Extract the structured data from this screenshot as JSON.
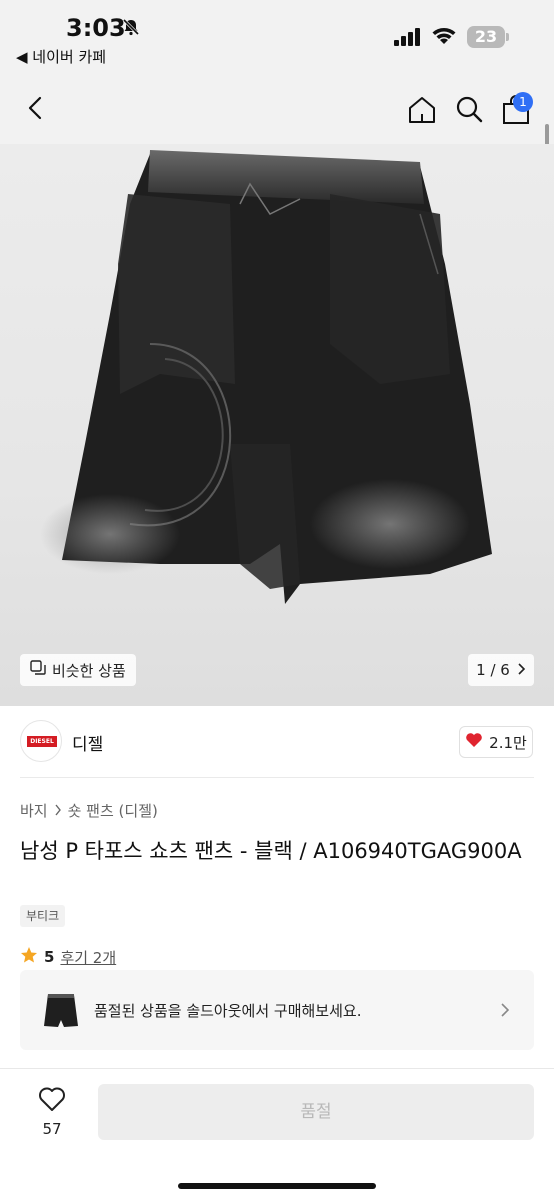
{
  "status_bar": {
    "time": "3:03",
    "back_app": "◀ 네이버 카페",
    "battery": "23",
    "icons": [
      "bell-off-icon",
      "signal-icon",
      "wifi-icon",
      "battery-icon"
    ]
  },
  "nav": {
    "icons": [
      "chevron-left-icon",
      "home-icon",
      "search-icon",
      "bag-icon"
    ],
    "cart_badge": "1"
  },
  "gallery": {
    "similar_label": "비슷한 상품",
    "pager": "1 / 6",
    "image": "black-shorts-photo"
  },
  "brand": {
    "logo_text": "DIESEL",
    "name": "디젤",
    "likes": "2.1만"
  },
  "product": {
    "breadcrumb": [
      "바지",
      "숏 팬츠 (디젤)"
    ],
    "title": "남성 P 타포스 쇼츠 팬츠 - 블랙 / A106940TGAG900A",
    "tag": "부티크",
    "rating": "5",
    "review_link": "후기 2개"
  },
  "soldout_banner": {
    "text": "품절된 상품을 솔드아웃에서 구매해보세요."
  },
  "bottom_bar": {
    "wish_count": "57",
    "buy_label": "품절"
  },
  "colors": {
    "badge": "#2f6ff5",
    "heart": "#e0242f",
    "star": "#f5a623",
    "brand_red": "#d41c23"
  }
}
